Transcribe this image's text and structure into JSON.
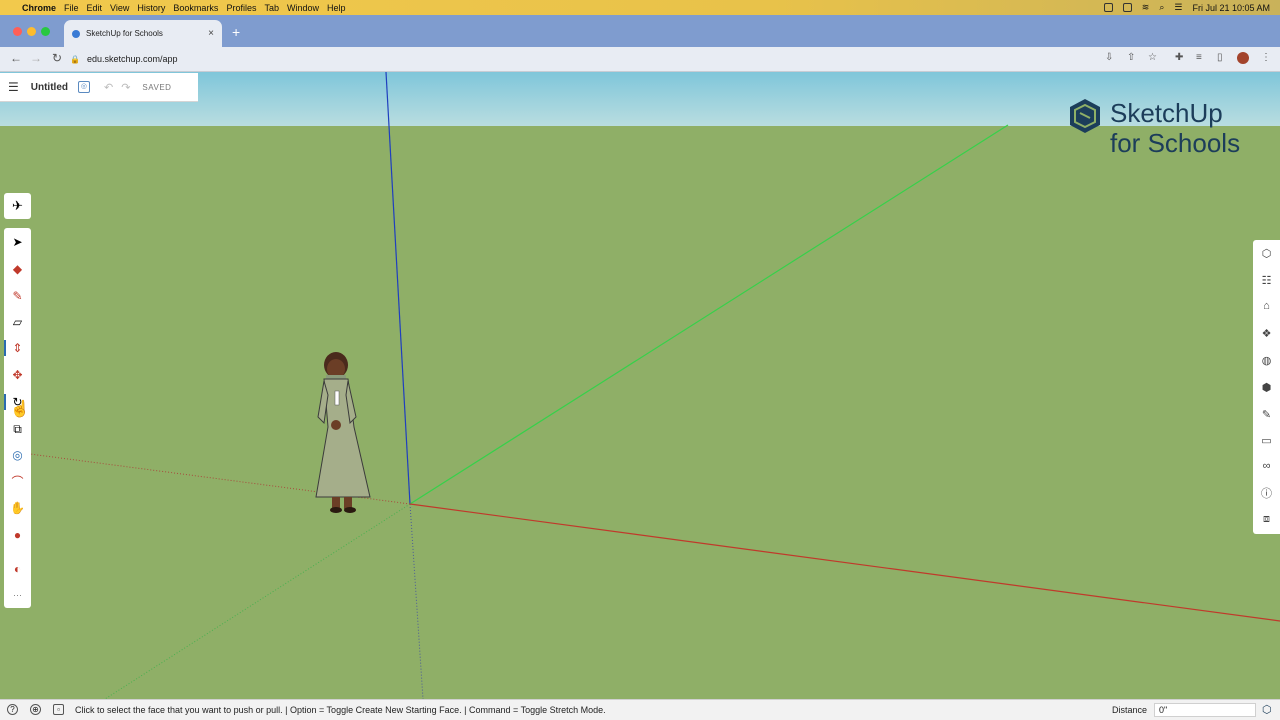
{
  "menubar": {
    "app": "Chrome",
    "items": [
      "File",
      "Edit",
      "View",
      "History",
      "Bookmarks",
      "Profiles",
      "Tab",
      "Window",
      "Help"
    ],
    "clock": "Fri Jul 21  10:05 AM"
  },
  "browser": {
    "tab_title": "SketchUp for Schools",
    "url": "edu.sketchup.com/app"
  },
  "file_panel": {
    "title": "Untitled",
    "status": "SAVED"
  },
  "logo": {
    "line1": "SketchUp",
    "line2": "for Schools"
  },
  "left_tools": [
    {
      "name": "select-tool-icon",
      "glyph": "➤"
    },
    {
      "name": "eraser-tool-icon",
      "glyph": "◆"
    },
    {
      "name": "pencil-tool-icon",
      "glyph": "✎"
    },
    {
      "name": "shape-tool-icon",
      "glyph": "▱"
    },
    {
      "name": "push-pull-tool-icon",
      "glyph": "⇕"
    },
    {
      "name": "move-tool-icon",
      "glyph": "✥"
    },
    {
      "name": "rotate-tool-icon",
      "glyph": "↻"
    },
    {
      "name": "scale-tool-icon",
      "glyph": "⧉"
    },
    {
      "name": "orbit-tool-icon",
      "glyph": "◎"
    },
    {
      "name": "tape-measure-tool-icon",
      "glyph": "⌒"
    },
    {
      "name": "pan-tool-icon",
      "glyph": "✋"
    },
    {
      "name": "paint-bucket-tool-icon",
      "glyph": "●"
    },
    {
      "name": "section-plane-tool-icon",
      "glyph": "◐"
    },
    {
      "name": "more-tools-icon",
      "glyph": "···"
    }
  ],
  "right_tools": [
    "entity-info-icon",
    "outliner-icon",
    "instructor-icon",
    "components-icon",
    "materials-icon",
    "styles-icon",
    "tags-icon",
    "scenes-icon",
    "display-icon",
    "info-icon",
    "extensions-icon"
  ],
  "status_bar": {
    "hint": "Click to select the face that you want to push or pull.  |  Option = Toggle Create New Starting Face.  |  Command = Toggle Stretch Mode.",
    "distance_label": "Distance",
    "distance_value": "0\""
  },
  "colors": {
    "ground": "#8faf67",
    "red_axis": "#c0392b",
    "green_axis": "#2ecc40",
    "blue_axis": "#1f3fbf",
    "brand": "#1c3d5a"
  }
}
